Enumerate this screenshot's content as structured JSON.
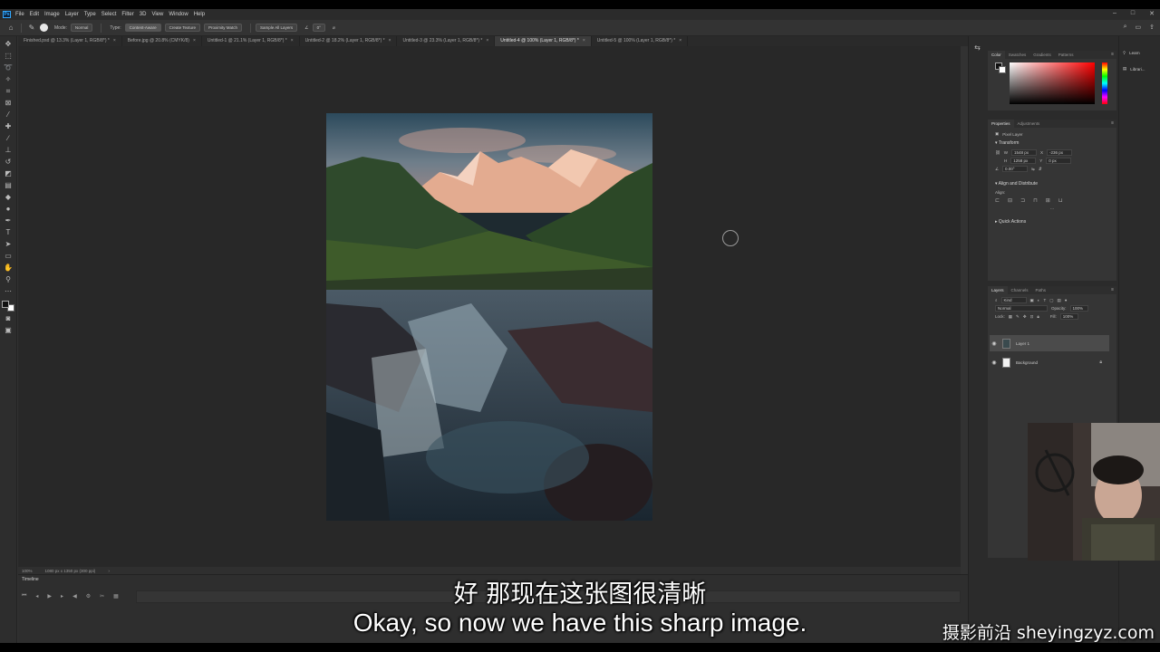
{
  "menubar": {
    "logo": "Ps",
    "items": [
      "File",
      "Edit",
      "Image",
      "Layer",
      "Type",
      "Select",
      "Filter",
      "3D",
      "View",
      "Window",
      "Help"
    ]
  },
  "options": {
    "mode_label": "Mode:",
    "mode_value": "Normal",
    "type_label": "Type:",
    "content_aware": "Content-Aware",
    "create_texture": "Create Texture",
    "proximity_match": "Proximity Match",
    "sample_all_layers": "Sample All Layers",
    "angle_value": "0°"
  },
  "tabs": [
    {
      "label": "Finished.psd @ 13.3% (Layer 1, RGB/8*) *"
    },
    {
      "label": "Before.jpg @ 20.8% (CMYK/8)"
    },
    {
      "label": "Untitled-1 @ 21.1% (Layer 1, RGB/8*) *"
    },
    {
      "label": "Untitled-2 @ 18.2% (Layer 1, RGB/8*) *"
    },
    {
      "label": "Untitled-3 @ 23.3% (Layer 1, RGB/8*) *"
    },
    {
      "label": "Untitled-4 @ 100% (Layer 1, RGB/8*) *"
    },
    {
      "label": "Untitled-5 @ 100% (Layer 1, RGB/8*) *"
    }
  ],
  "status": {
    "zoom": "100%",
    "size": "1080 px x 1350 px (300 ppi)"
  },
  "timeline": {
    "title": "Timeline"
  },
  "color_panel": {
    "tabs": [
      "Color",
      "Swatches",
      "Gradients",
      "Patterns"
    ]
  },
  "properties_panel": {
    "tabs": [
      "Properties",
      "Adjustments"
    ],
    "pixel_layer": "Pixel Layer",
    "transform_title": "Transform",
    "w_label": "W",
    "w_value": "1548 px",
    "x_label": "X",
    "x_value": "-236 px",
    "h_label": "H",
    "h_value": "1258 px",
    "y_label": "Y",
    "y_value": "0 px",
    "angle_value": "0.00°",
    "align_title": "Align and Distribute",
    "align_label": "Align:",
    "quick_actions_title": "Quick Actions"
  },
  "layers_panel": {
    "tabs": [
      "Layers",
      "Channels",
      "Paths"
    ],
    "kind": "Kind",
    "blend_mode": "Normal",
    "opacity_label": "Opacity:",
    "opacity_value": "100%",
    "lock_label": "Lock:",
    "fill_label": "Fill:",
    "fill_value": "100%",
    "layers": [
      {
        "name": "Layer 1"
      },
      {
        "name": "Background"
      }
    ]
  },
  "mini_panel": {
    "learn": "Learn",
    "libraries": "Librari..."
  },
  "subtitles": {
    "cn": "好 那现在这张图很清晰",
    "en": "Okay, so now we have this sharp image.",
    "watermark": "摄影前沿 sheyingzyz.com"
  }
}
